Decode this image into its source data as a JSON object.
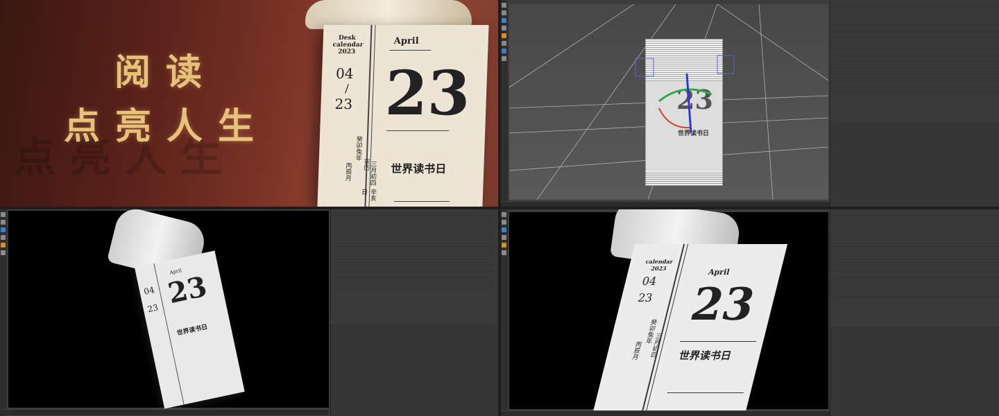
{
  "hero": {
    "line1": "阅读",
    "line2": "点亮人生",
    "ghost": "点亮人生"
  },
  "calendar": {
    "brand_line1": "Desk",
    "brand_line2": "calendar",
    "year": "2023",
    "month": "April",
    "date_top": "04",
    "slash": "/",
    "date_bottom": "23",
    "day": "23",
    "event": "世界读书日",
    "lunar_col1": "癸卯兔年",
    "lunar_col2": "丙辰月",
    "lunar_col3": "农历",
    "lunar_col4": "三月初四",
    "lunar_col5": "辛亥日"
  },
  "ui": {
    "left_tool_icons": [
      "move-icon",
      "scale-icon",
      "rotate-icon",
      "render-icon",
      "camera-icon",
      "light-icon"
    ],
    "colors": {
      "gold": "#e8c27a",
      "viewport_bg": "#000000",
      "editor_bg": "#3d3d3d",
      "axis_blue": "#2e39d8",
      "axis_green": "#2fa84f",
      "axis_red": "#d43a2a"
    }
  }
}
